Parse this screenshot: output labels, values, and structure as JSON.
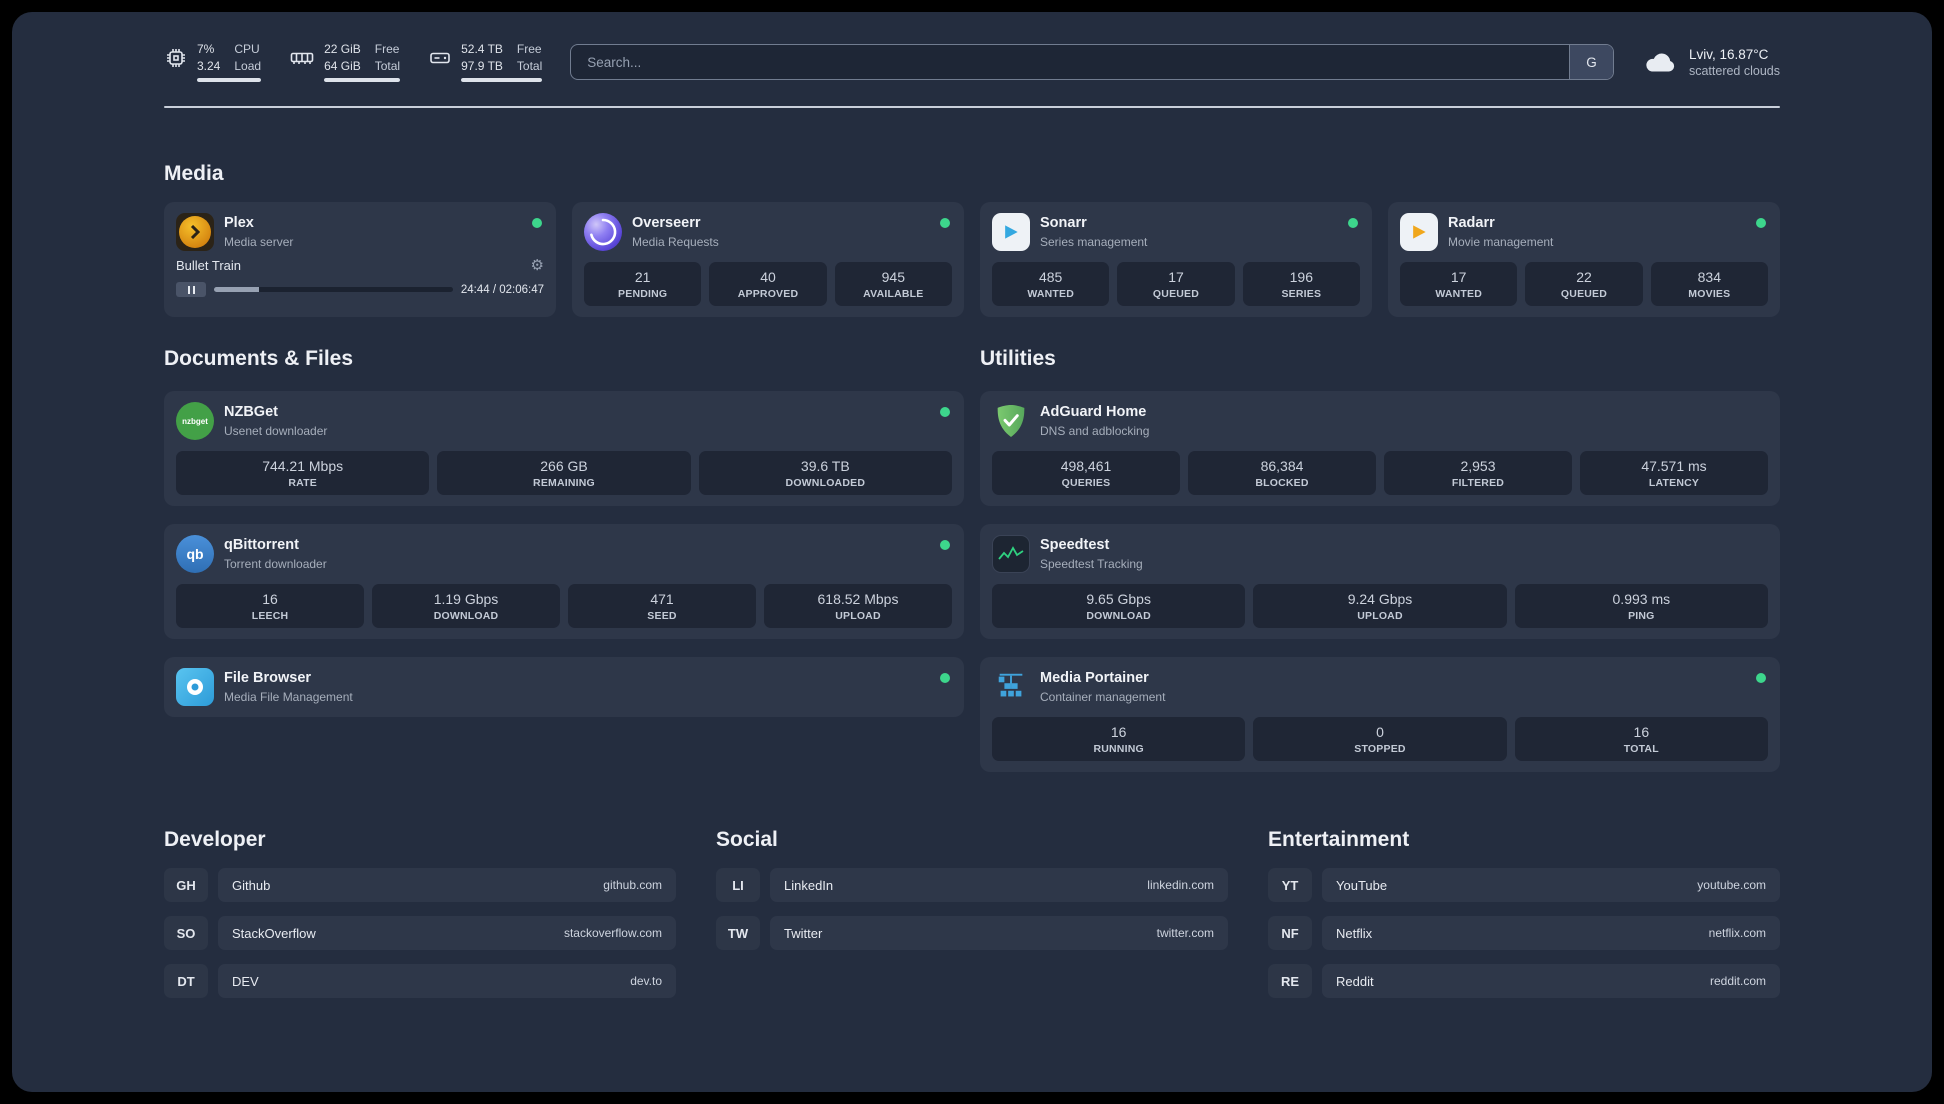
{
  "topbar": {
    "cpu": {
      "value_top": "7%",
      "label_top": "CPU",
      "value_bottom": "3.24",
      "label_bottom": "Load"
    },
    "memory": {
      "value_top": "22 GiB",
      "label_top": "Free",
      "value_bottom": "64 GiB",
      "label_bottom": "Total"
    },
    "disk": {
      "value_top": "52.4 TB",
      "label_top": "Free",
      "value_bottom": "97.9 TB",
      "label_bottom": "Total"
    },
    "search": {
      "placeholder": "Search...",
      "button_label": "G"
    },
    "weather": {
      "location": "Lviv, 16.87°C",
      "condition": "scattered clouds"
    }
  },
  "media": {
    "title": "Media",
    "plex": {
      "name": "Plex",
      "desc": "Media server",
      "now_playing": "Bullet Train",
      "progress_time": "24:44 / 02:06:47"
    },
    "overseerr": {
      "name": "Overseerr",
      "desc": "Media Requests",
      "stats": [
        {
          "value": "21",
          "label": "PENDING"
        },
        {
          "value": "40",
          "label": "APPROVED"
        },
        {
          "value": "945",
          "label": "AVAILABLE"
        }
      ]
    },
    "sonarr": {
      "name": "Sonarr",
      "desc": "Series management",
      "stats": [
        {
          "value": "485",
          "label": "WANTED"
        },
        {
          "value": "17",
          "label": "QUEUED"
        },
        {
          "value": "196",
          "label": "SERIES"
        }
      ]
    },
    "radarr": {
      "name": "Radarr",
      "desc": "Movie management",
      "stats": [
        {
          "value": "17",
          "label": "WANTED"
        },
        {
          "value": "22",
          "label": "QUEUED"
        },
        {
          "value": "834",
          "label": "MOVIES"
        }
      ]
    }
  },
  "documents": {
    "title": "Documents & Files",
    "nzbget": {
      "name": "NZBGet",
      "desc": "Usenet downloader",
      "icon_label": "nzbget",
      "stats": [
        {
          "value": "744.21 Mbps",
          "label": "RATE"
        },
        {
          "value": "266 GB",
          "label": "REMAINING"
        },
        {
          "value": "39.6 TB",
          "label": "DOWNLOADED"
        }
      ]
    },
    "qbittorrent": {
      "name": "qBittorrent",
      "desc": "Torrent downloader",
      "icon_label": "qb",
      "stats": [
        {
          "value": "16",
          "label": "LEECH"
        },
        {
          "value": "1.19 Gbps",
          "label": "DOWNLOAD"
        },
        {
          "value": "471",
          "label": "SEED"
        },
        {
          "value": "618.52 Mbps",
          "label": "UPLOAD"
        }
      ]
    },
    "filebrowser": {
      "name": "File Browser",
      "desc": "Media File Management"
    }
  },
  "utilities": {
    "title": "Utilities",
    "adguard": {
      "name": "AdGuard Home",
      "desc": "DNS and adblocking",
      "stats": [
        {
          "value": "498,461",
          "label": "QUERIES"
        },
        {
          "value": "86,384",
          "label": "BLOCKED"
        },
        {
          "value": "2,953",
          "label": "FILTERED"
        },
        {
          "value": "47.571 ms",
          "label": "LATENCY"
        }
      ]
    },
    "speedtest": {
      "name": "Speedtest",
      "desc": "Speedtest Tracking",
      "stats": [
        {
          "value": "9.65 Gbps",
          "label": "DOWNLOAD"
        },
        {
          "value": "9.24 Gbps",
          "label": "UPLOAD"
        },
        {
          "value": "0.993 ms",
          "label": "PING"
        }
      ]
    },
    "portainer": {
      "name": "Media Portainer",
      "desc": "Container management",
      "stats": [
        {
          "value": "16",
          "label": "RUNNING"
        },
        {
          "value": "0",
          "label": "STOPPED"
        },
        {
          "value": "16",
          "label": "TOTAL"
        }
      ]
    }
  },
  "bookmarks": {
    "developer": {
      "title": "Developer",
      "links": [
        {
          "abbr": "GH",
          "name": "Github",
          "url": "github.com"
        },
        {
          "abbr": "SO",
          "name": "StackOverflow",
          "url": "stackoverflow.com"
        },
        {
          "abbr": "DT",
          "name": "DEV",
          "url": "dev.to"
        }
      ]
    },
    "social": {
      "title": "Social",
      "links": [
        {
          "abbr": "LI",
          "name": "LinkedIn",
          "url": "linkedin.com"
        },
        {
          "abbr": "TW",
          "name": "Twitter",
          "url": "twitter.com"
        }
      ]
    },
    "entertainment": {
      "title": "Entertainment",
      "links": [
        {
          "abbr": "YT",
          "name": "YouTube",
          "url": "youtube.com"
        },
        {
          "abbr": "NF",
          "name": "Netflix",
          "url": "netflix.com"
        },
        {
          "abbr": "RE",
          "name": "Reddit",
          "url": "reddit.com"
        }
      ]
    }
  },
  "colors": {
    "panel": "#242d3f",
    "card": "#2e3749",
    "status_online": "#3dd68c"
  }
}
